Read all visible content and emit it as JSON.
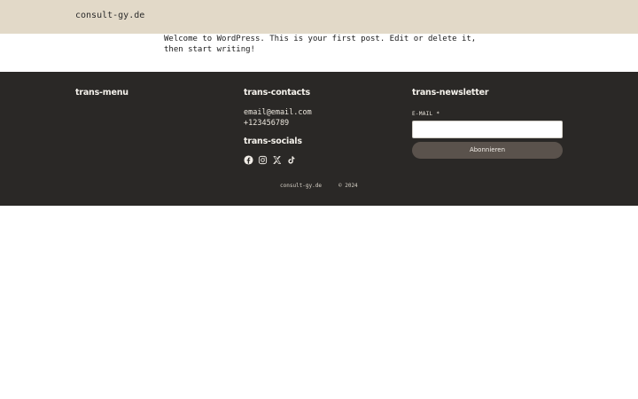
{
  "header": {
    "site_title": "consult-gy.de"
  },
  "post": {
    "content": "Welcome to WordPress. This is your first post. Edit or delete it, then start writing!"
  },
  "footer": {
    "menu": {
      "heading": "trans-menu"
    },
    "contacts": {
      "heading": "trans-contacts",
      "email": "email@email.com",
      "phone": "+123456789"
    },
    "socials": {
      "heading": "trans-socials",
      "icons": [
        "facebook-icon",
        "instagram-icon",
        "x-icon",
        "tiktok-icon"
      ]
    },
    "newsletter": {
      "heading": "trans-newsletter",
      "email_label": "E-MAIL *",
      "email_value": "",
      "subscribe_label": "Abonnieren"
    },
    "bottom": {
      "site": "consult-gy.de",
      "copyright": "© 2024"
    }
  },
  "colors": {
    "header_bg": "#e2d9c8",
    "footer_bg": "#2a2826",
    "button_bg": "#5a524c"
  }
}
